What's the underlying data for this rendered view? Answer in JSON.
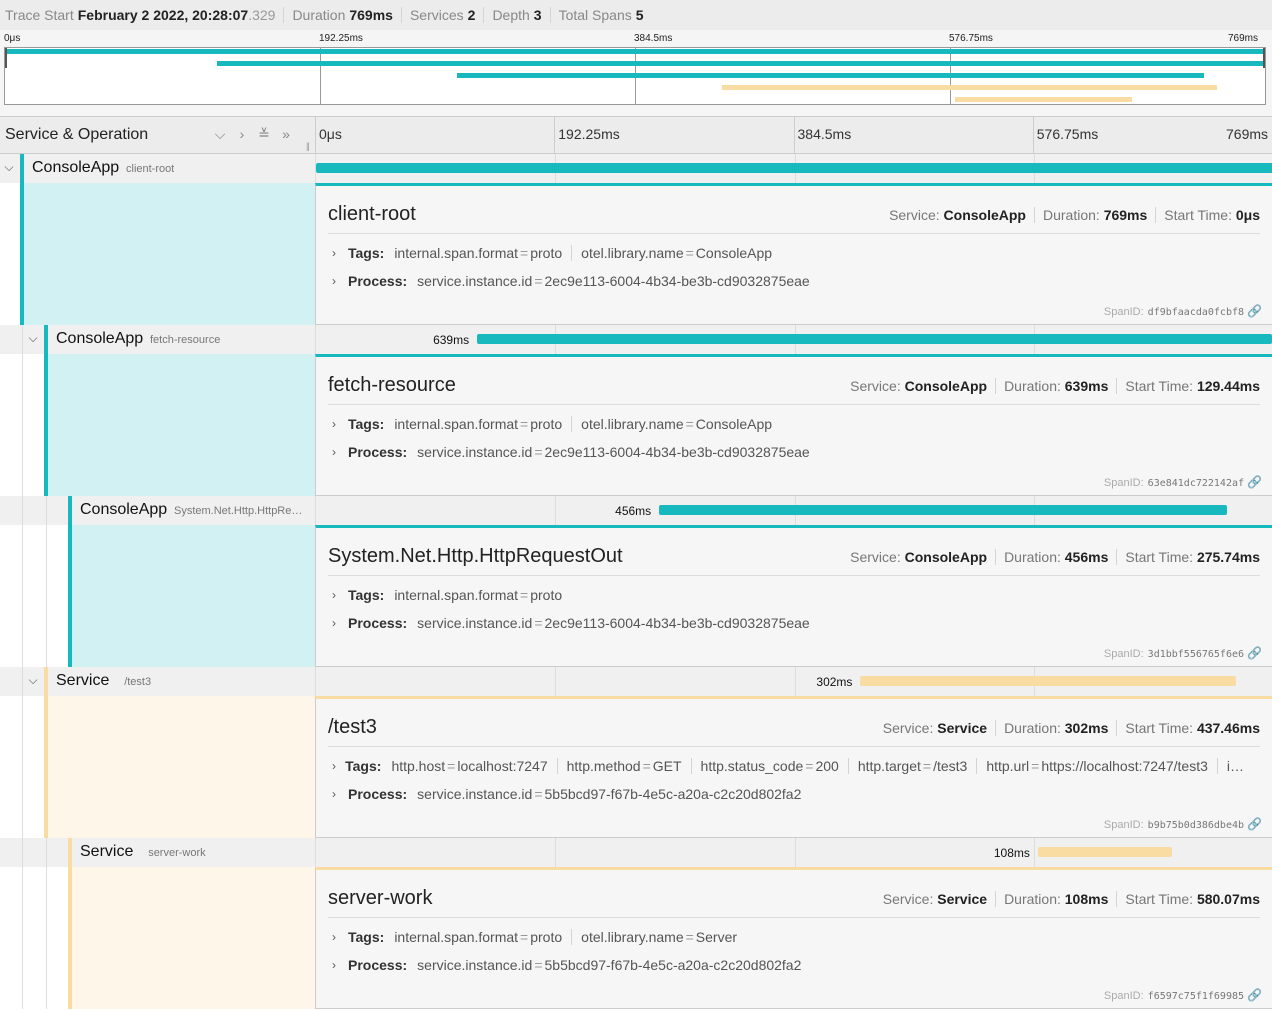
{
  "header": {
    "trace_start_label": "Trace Start",
    "trace_start_value": "February 2 2022, 20:28:07",
    "trace_start_ms": ".329",
    "duration_label": "Duration",
    "duration_value": "769ms",
    "services_label": "Services",
    "services_value": "2",
    "depth_label": "Depth",
    "depth_value": "3",
    "total_spans_label": "Total Spans",
    "total_spans_value": "5"
  },
  "ticks": [
    "0μs",
    "192.25ms",
    "384.5ms",
    "576.75ms",
    "769ms"
  ],
  "columns": {
    "title": "Service & Operation"
  },
  "icons": {
    "collapse_one": "chevron-down-icon",
    "expand_one": "chevron-right-icon",
    "expand_all": "double-chevron-down-icon",
    "collapse_all": "double-chevron-right-icon",
    "link": "link-icon"
  },
  "colors": {
    "console_app": "#17b8be",
    "console_app_light": "#d2f1f2",
    "service": "#f8dca1",
    "service_light": "#fef6e8"
  },
  "trace_duration_ms": 769,
  "labels": {
    "service": "Service:",
    "duration": "Duration:",
    "start_time": "Start Time:",
    "tags": "Tags:",
    "process": "Process:",
    "span_id": "SpanID:"
  },
  "spans": [
    {
      "service": "ConsoleApp",
      "operation": "client-root",
      "depth": 0,
      "color_key": "console_app",
      "start_ms": 0,
      "duration_ms": 769,
      "duration_label": "",
      "detail": {
        "title": "client-root",
        "service": "ConsoleApp",
        "duration": "769ms",
        "start_time": "0μs",
        "tags": [
          {
            "k": "internal.span.format",
            "v": "proto"
          },
          {
            "k": "otel.library.name",
            "v": "ConsoleApp"
          }
        ],
        "process": [
          {
            "k": "service.instance.id",
            "v": "2ec9e113-6004-4b34-be3b-cd9032875eae"
          }
        ],
        "span_id": "df9bfaacda0fcbf8"
      }
    },
    {
      "service": "ConsoleApp",
      "operation": "fetch-resource",
      "depth": 1,
      "color_key": "console_app",
      "start_ms": 129.44,
      "duration_ms": 639,
      "duration_label": "639ms",
      "detail": {
        "title": "fetch-resource",
        "service": "ConsoleApp",
        "duration": "639ms",
        "start_time": "129.44ms",
        "tags": [
          {
            "k": "internal.span.format",
            "v": "proto"
          },
          {
            "k": "otel.library.name",
            "v": "ConsoleApp"
          }
        ],
        "process": [
          {
            "k": "service.instance.id",
            "v": "2ec9e113-6004-4b34-be3b-cd9032875eae"
          }
        ],
        "span_id": "63e841dc722142af"
      }
    },
    {
      "service": "ConsoleApp",
      "operation": "System.Net.Http.HttpRequestOut",
      "depth": 2,
      "color_key": "console_app",
      "start_ms": 275.74,
      "duration_ms": 456,
      "duration_label": "456ms",
      "detail": {
        "title": "System.Net.Http.HttpRequestOut",
        "service": "ConsoleApp",
        "duration": "456ms",
        "start_time": "275.74ms",
        "tags": [
          {
            "k": "internal.span.format",
            "v": "proto"
          }
        ],
        "process": [
          {
            "k": "service.instance.id",
            "v": "2ec9e113-6004-4b34-be3b-cd9032875eae"
          }
        ],
        "span_id": "3d1bbf556765f6e6"
      }
    },
    {
      "service": "Service",
      "operation": "/test3",
      "depth": 1,
      "color_key": "service",
      "start_ms": 437.46,
      "duration_ms": 302,
      "duration_label": "302ms",
      "detail": {
        "title": "/test3",
        "service": "Service",
        "duration": "302ms",
        "start_time": "437.46ms",
        "tags": [
          {
            "k": "http.host",
            "v": "localhost:7247"
          },
          {
            "k": "http.method",
            "v": "GET"
          },
          {
            "k": "http.status_code",
            "v": "200"
          },
          {
            "k": "http.target",
            "v": "/test3"
          },
          {
            "k": "http.url",
            "v": "https://localhost:7247/test3"
          },
          {
            "k": "i…",
            "v": ""
          }
        ],
        "process": [
          {
            "k": "service.instance.id",
            "v": "5b5bcd97-f67b-4e5c-a20a-c2c20d802fa2"
          }
        ],
        "span_id": "b9b75b0d386dbe4b"
      }
    },
    {
      "service": "Service",
      "operation": "server-work",
      "depth": 2,
      "color_key": "service",
      "start_ms": 580.07,
      "duration_ms": 108,
      "duration_label": "108ms",
      "detail": {
        "title": "server-work",
        "service": "Service",
        "duration": "108ms",
        "start_time": "580.07ms",
        "tags": [
          {
            "k": "internal.span.format",
            "v": "proto"
          },
          {
            "k": "otel.library.name",
            "v": "Server"
          }
        ],
        "process": [
          {
            "k": "service.instance.id",
            "v": "5b5bcd97-f67b-4e5c-a20a-c2c20d802fa2"
          }
        ],
        "span_id": "f6597c75f1f69985"
      }
    }
  ]
}
